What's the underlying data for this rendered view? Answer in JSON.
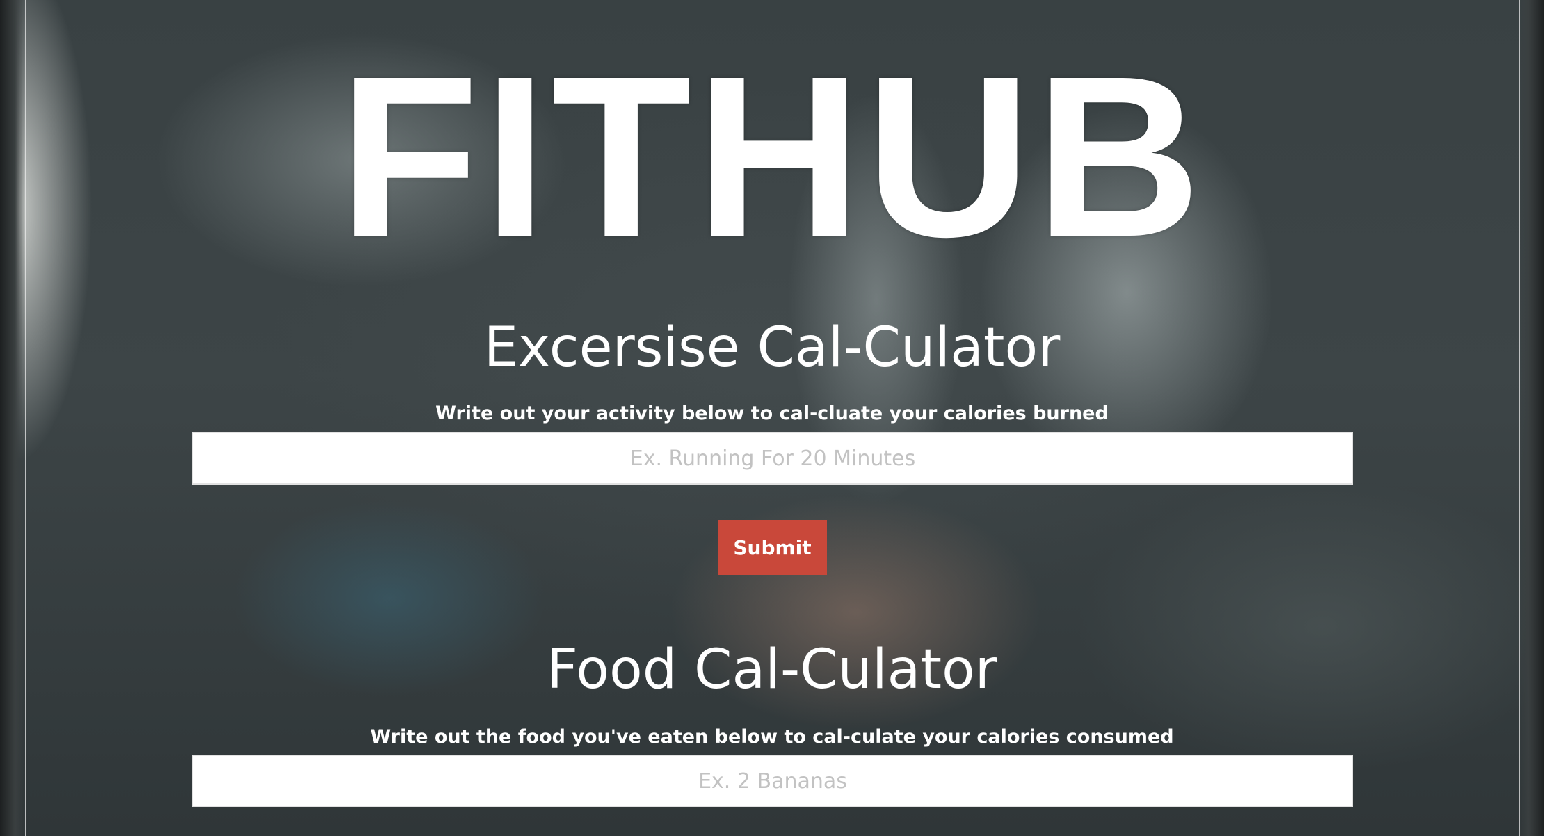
{
  "brand": {
    "logo_text": "FITHUB"
  },
  "exercise": {
    "title": "Excersise Cal-Culator",
    "description": "Write out your activity below to cal-cluate your calories burned",
    "input_placeholder": "Ex. Running For 20 Minutes",
    "input_value": "",
    "submit_label": "Submit"
  },
  "food": {
    "title": "Food Cal-Culator",
    "description": "Write out the food you've eaten below to cal-culate your calories consumed",
    "input_placeholder": "Ex. 2 Bananas",
    "input_value": ""
  },
  "colors": {
    "accent": "#c9483a",
    "text": "#ffffff",
    "input_bg": "#ffffff",
    "placeholder": "#c2c2c2"
  }
}
